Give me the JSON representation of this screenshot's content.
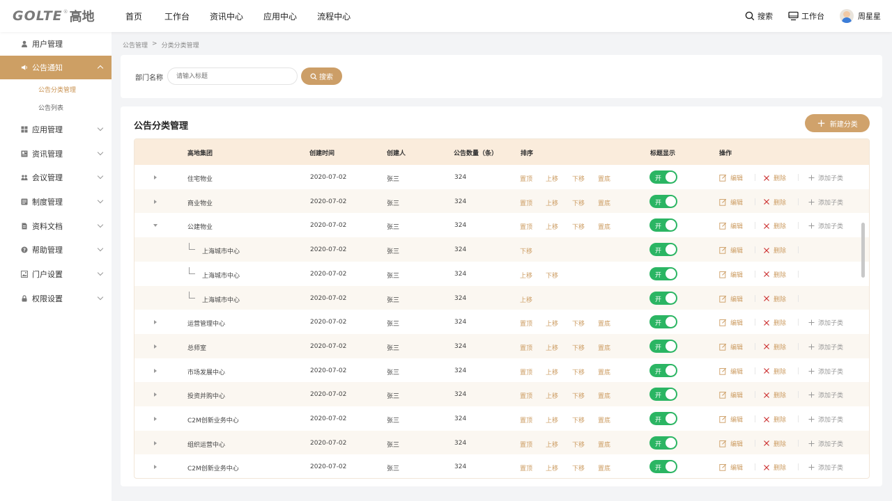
{
  "logo": {
    "latin": "GOLTE",
    "reg": "®",
    "cn": "高地"
  },
  "topnav": [
    "首页",
    "工作台",
    "资讯中心",
    "应用中心",
    "流程中心"
  ],
  "topright": {
    "search": "搜索",
    "workbench": "工作台",
    "user": "周星星"
  },
  "sidebar": {
    "items": [
      {
        "label": "用户管理",
        "icon": "user-icon"
      },
      {
        "label": "公告通知",
        "icon": "megaphone-icon",
        "active": true
      },
      {
        "label": "应用管理",
        "icon": "grid-icon"
      },
      {
        "label": "资讯管理",
        "icon": "news-icon"
      },
      {
        "label": "会议管理",
        "icon": "meeting-icon"
      },
      {
        "label": "制度管理",
        "icon": "rules-icon"
      },
      {
        "label": "资料文档",
        "icon": "document-icon"
      },
      {
        "label": "帮助管理",
        "icon": "help-icon"
      },
      {
        "label": "门户设置",
        "icon": "portal-icon"
      },
      {
        "label": "权限设置",
        "icon": "lock-icon"
      }
    ],
    "subitems": [
      "公告分类管理",
      "公告列表"
    ]
  },
  "breadcrumb": [
    "公告管理",
    ">",
    "分类分类管理"
  ],
  "search": {
    "label": "部门名称",
    "placeholder": "请输入标题",
    "button": "搜索"
  },
  "panel": {
    "title": "公告分类管理",
    "new_button": "新建分类"
  },
  "table": {
    "headers": [
      "高地集团",
      "创建时间",
      "创建人",
      "公告数量（条）",
      "排序",
      "标题显示",
      "操作"
    ],
    "toggle_label": "开",
    "ops": {
      "edit": "编辑",
      "delete": "删除",
      "add_child": "添加子类"
    },
    "sort_labels": {
      "top": "置顶",
      "up": "上移",
      "down": "下移",
      "bottom": "置底"
    },
    "rows": [
      {
        "name": "住宅物业",
        "date": "2020-07-02",
        "creator": "张三",
        "count": "324",
        "level": 0,
        "expand": "closed",
        "sort": [
          "top",
          "up",
          "down",
          "bottom"
        ],
        "add_child": true
      },
      {
        "name": "商业物业",
        "date": "2020-07-02",
        "creator": "张三",
        "count": "324",
        "level": 0,
        "expand": "closed",
        "sort": [
          "top",
          "up",
          "down",
          "bottom"
        ],
        "add_child": true
      },
      {
        "name": "公建物业",
        "date": "2020-07-02",
        "creator": "张三",
        "count": "324",
        "level": 0,
        "expand": "open",
        "sort": [
          "top",
          "up",
          "down",
          "bottom"
        ],
        "add_child": true
      },
      {
        "name": "上海城市中心",
        "date": "2020-07-02",
        "creator": "张三",
        "count": "324",
        "level": 1,
        "expand": "none",
        "sort": [
          "down"
        ],
        "add_child": false
      },
      {
        "name": "上海城市中心",
        "date": "2020-07-02",
        "creator": "张三",
        "count": "324",
        "level": 1,
        "expand": "none",
        "sort": [
          "up",
          "down"
        ],
        "add_child": false
      },
      {
        "name": "上海城市中心",
        "date": "2020-07-02",
        "creator": "张三",
        "count": "324",
        "level": 1,
        "expand": "none",
        "sort": [
          "up"
        ],
        "add_child": false
      },
      {
        "name": "运营管理中心",
        "date": "2020-07-02",
        "creator": "张三",
        "count": "324",
        "level": 0,
        "expand": "closed",
        "sort": [
          "top",
          "up",
          "down",
          "bottom"
        ],
        "add_child": true
      },
      {
        "name": "总师室",
        "date": "2020-07-02",
        "creator": "张三",
        "count": "324",
        "level": 0,
        "expand": "closed",
        "sort": [
          "top",
          "up",
          "down",
          "bottom"
        ],
        "add_child": true
      },
      {
        "name": "市场发展中心",
        "date": "2020-07-02",
        "creator": "张三",
        "count": "324",
        "level": 0,
        "expand": "closed",
        "sort": [
          "top",
          "up",
          "down",
          "bottom"
        ],
        "add_child": true
      },
      {
        "name": "投资并购中心",
        "date": "2020-07-02",
        "creator": "张三",
        "count": "324",
        "level": 0,
        "expand": "closed",
        "sort": [
          "top",
          "up",
          "down",
          "bottom"
        ],
        "add_child": true
      },
      {
        "name": "C2M创新业务中心",
        "date": "2020-07-02",
        "creator": "张三",
        "count": "324",
        "level": 0,
        "expand": "closed",
        "sort": [
          "top",
          "up",
          "down",
          "bottom"
        ],
        "add_child": true
      },
      {
        "name": "组织运营中心",
        "date": "2020-07-02",
        "creator": "张三",
        "count": "324",
        "level": 0,
        "expand": "closed",
        "sort": [
          "top",
          "up",
          "down",
          "bottom"
        ],
        "add_child": true
      },
      {
        "name": "C2M创新业务中心",
        "date": "2020-07-02",
        "creator": "张三",
        "count": "324",
        "level": 0,
        "expand": "closed",
        "sort": [
          "top",
          "up",
          "down",
          "bottom"
        ],
        "add_child": true
      }
    ]
  },
  "colors": {
    "accent": "#cd9f64",
    "toggle_on": "#2bb563",
    "header_bg": "#faecdc",
    "link": "#cc9c62"
  }
}
